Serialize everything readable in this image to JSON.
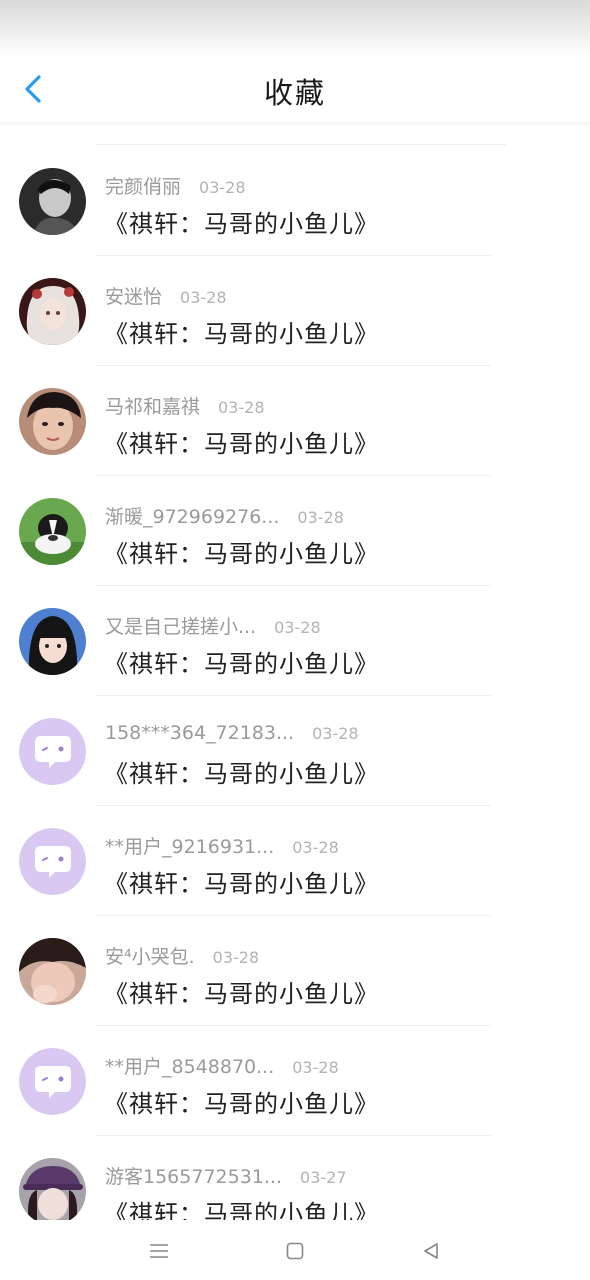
{
  "header": {
    "title": "收藏",
    "back_icon": "chevron-left-icon",
    "accent_color": "#2a9af0"
  },
  "items": [
    {
      "name": "完颜俏丽",
      "date": "03-28",
      "work": "《祺轩：马哥的小鱼儿》",
      "avatar": "photo-man"
    },
    {
      "name": "安迷怡",
      "date": "03-28",
      "work": "《祺轩：马哥的小鱼儿》",
      "avatar": "photo-doll"
    },
    {
      "name": "马祁和嘉祺",
      "date": "03-28",
      "work": "《祺轩：马哥的小鱼儿》",
      "avatar": "photo-boy"
    },
    {
      "name": "渐暖_972969276...",
      "date": "03-28",
      "work": "《祺轩：马哥的小鱼儿》",
      "avatar": "photo-dog"
    },
    {
      "name": "又是自己搓搓小...",
      "date": "03-28",
      "work": "《祺轩：马哥的小鱼儿》",
      "avatar": "photo-girl"
    },
    {
      "name": "158***364_72183...",
      "date": "03-28",
      "work": "《祺轩：马哥的小鱼儿》",
      "avatar": "default-chat-bubble"
    },
    {
      "name": "**用户_9216931...",
      "date": "03-28",
      "work": "《祺轩：马哥的小鱼儿》",
      "avatar": "default-chat-bubble"
    },
    {
      "name": "安⁴小哭包.",
      "date": "03-28",
      "work": "《祺轩：马哥的小鱼儿》",
      "avatar": "photo-face"
    },
    {
      "name": "**用户_8548870...",
      "date": "03-28",
      "work": "《祺轩：马哥的小鱼儿》",
      "avatar": "default-chat-bubble"
    },
    {
      "name": "游客1565772531...",
      "date": "03-27",
      "work": "《祺轩：马哥的小鱼儿》",
      "avatar": "photo-cap"
    }
  ],
  "navbar": {
    "menu_icon": "menu-icon",
    "home_icon": "home-square-icon",
    "back_icon": "back-triangle-icon"
  }
}
